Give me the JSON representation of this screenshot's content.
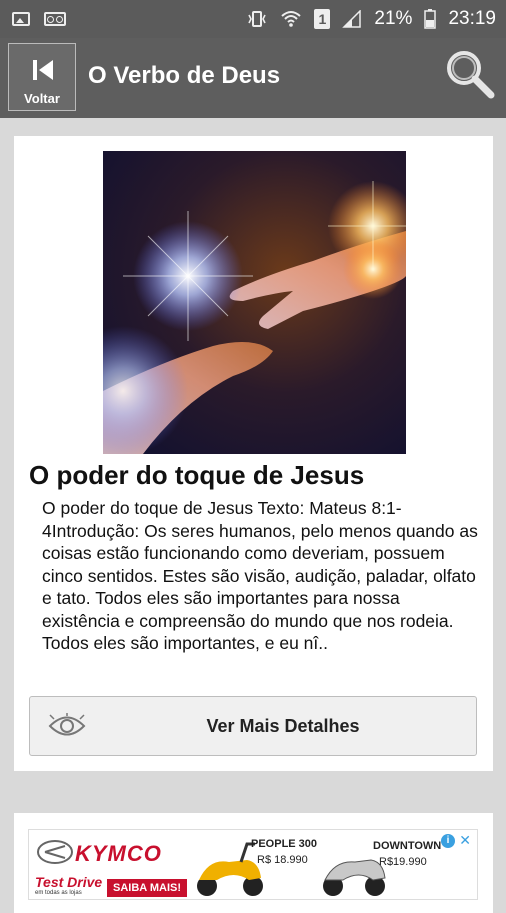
{
  "status_bar": {
    "battery_percent": "21%",
    "time": "23:19",
    "sim_label": "1"
  },
  "app_bar": {
    "back_label": "Voltar",
    "title": "O Verbo de Deus"
  },
  "post": {
    "title": "O poder do toque de Jesus",
    "excerpt": "O poder do toque de Jesus Texto: Mateus 8:1-4Introdução: Os seres humanos, pelo menos quando as coisas estão funcionando como deveriam, possuem cinco sentidos. Estes são visão, audição, paladar, olfato e tato. Todos eles são importantes para nossa existência e compreensão do mundo que nos rodeia. Todos eles são importantes, e eu nî..",
    "more_button_label": "Ver Mais Detalhes"
  },
  "ad": {
    "brand": "KYMCO",
    "test_drive": "Test Drive",
    "test_drive_sub": "em todas as lojas",
    "cta": "SAIBA MAIS!",
    "product1_name": "PEOPLE 300",
    "product1_price": "R$ 18.990",
    "product2_name": "DOWNTOWN",
    "product2_price": "R$19.990"
  },
  "colors": {
    "app_bar": "#5e5e5e",
    "background": "#d9d9d9",
    "ad_red": "#c8102e"
  }
}
